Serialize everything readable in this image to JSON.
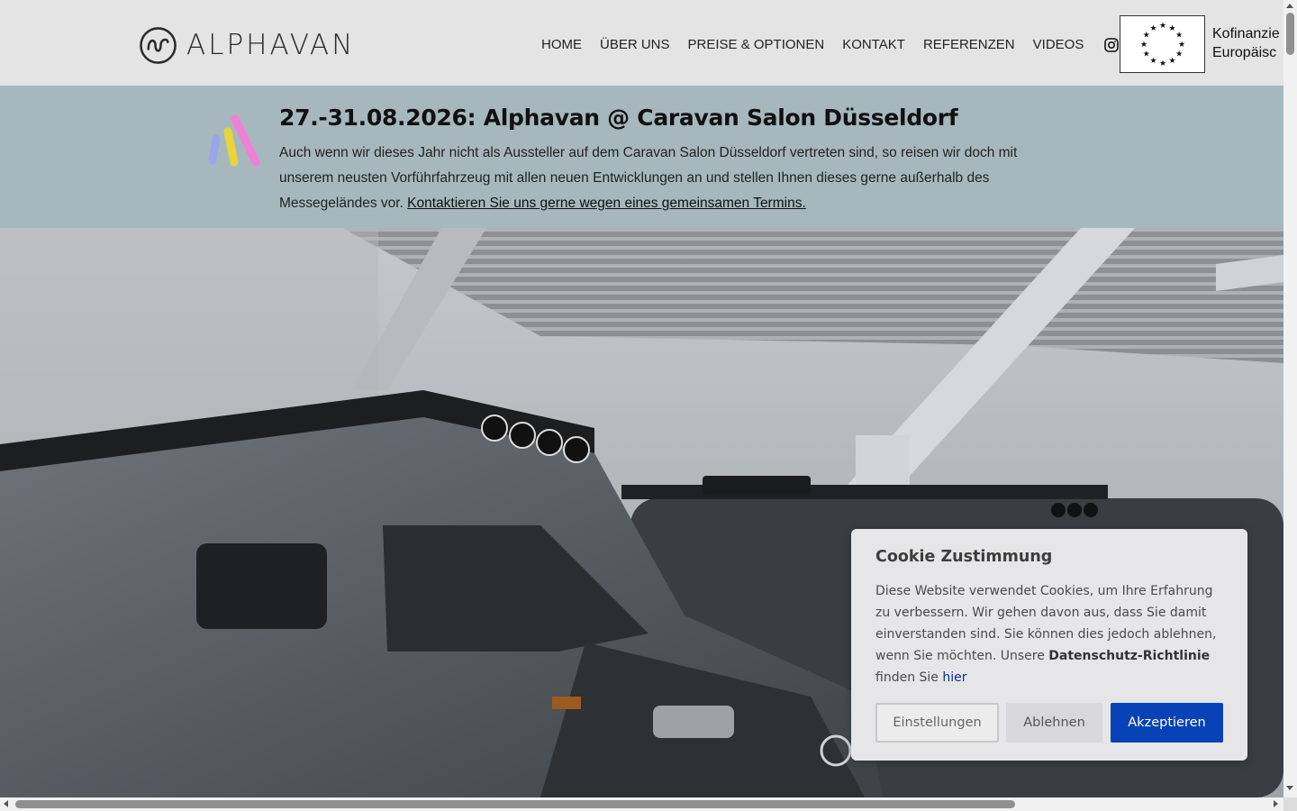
{
  "header": {
    "brand": "ALPHAVAN",
    "nav": [
      "HOME",
      "ÜBER UNS",
      "PREISE & OPTIONEN",
      "KONTAKT",
      "REFERENZEN",
      "VIDEOS"
    ],
    "eu_line1": "Kofinanzie",
    "eu_line2": "Europäisc"
  },
  "banner": {
    "title": "27.-31.08.2026: Alphavan @ Caravan Salon Düsseldorf",
    "text": "Auch wenn wir dieses Jahr nicht als Aussteller auf dem Caravan Salon Düsseldorf vertreten sind, so reisen wir doch mit unserem neusten Vorführfahrzeug mit allen neuen Entwicklungen an und stellen Ihnen dieses gerne außerhalb des Messegeländes vor.",
    "link": "Kontaktieren Sie uns gerne wegen eines gemeinsamen Termins."
  },
  "cookie": {
    "title": "Cookie Zustimmung",
    "text": "Diese Website verwendet Cookies, um Ihre Erfahrung zu verbessern. Wir gehen davon aus, dass Sie damit einverstanden sind. Sie können dies jedoch ablehnen, wenn Sie möchten. Unsere",
    "policy": "Datenschutz-Richtlinie",
    "find": "finden Sie",
    "link": "hier",
    "btn_settings": "Einstellungen",
    "btn_decline": "Ablehnen",
    "btn_accept": "Akzeptieren"
  },
  "colors": {
    "header_bg": "#e4e4e4",
    "banner_bg": "#a6b8bd",
    "accept_bg": "#0842b7",
    "link": "#0a2a9e"
  },
  "icons": [
    "alphavan-logo-icon",
    "instagram-icon",
    "facebook-icon",
    "eu-flag-icon",
    "brand-stripes-icon"
  ]
}
